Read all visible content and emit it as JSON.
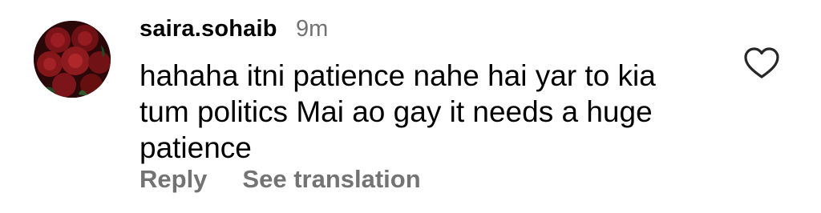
{
  "comment": {
    "username": "saira.sohaib",
    "time": "9m",
    "text_lines": [
      "hahaha itni patience nahe hai yar to kia",
      "tum politics Mai ao gay it needs a huge",
      "patience"
    ],
    "actions": {
      "reply_label": "Reply",
      "translate_label": "See translation"
    },
    "avatar_icon": "red-roses-avatar",
    "like_icon": "heart-outline-icon"
  },
  "colors": {
    "text": "#000000",
    "muted": "#737373",
    "background": "#ffffff"
  }
}
